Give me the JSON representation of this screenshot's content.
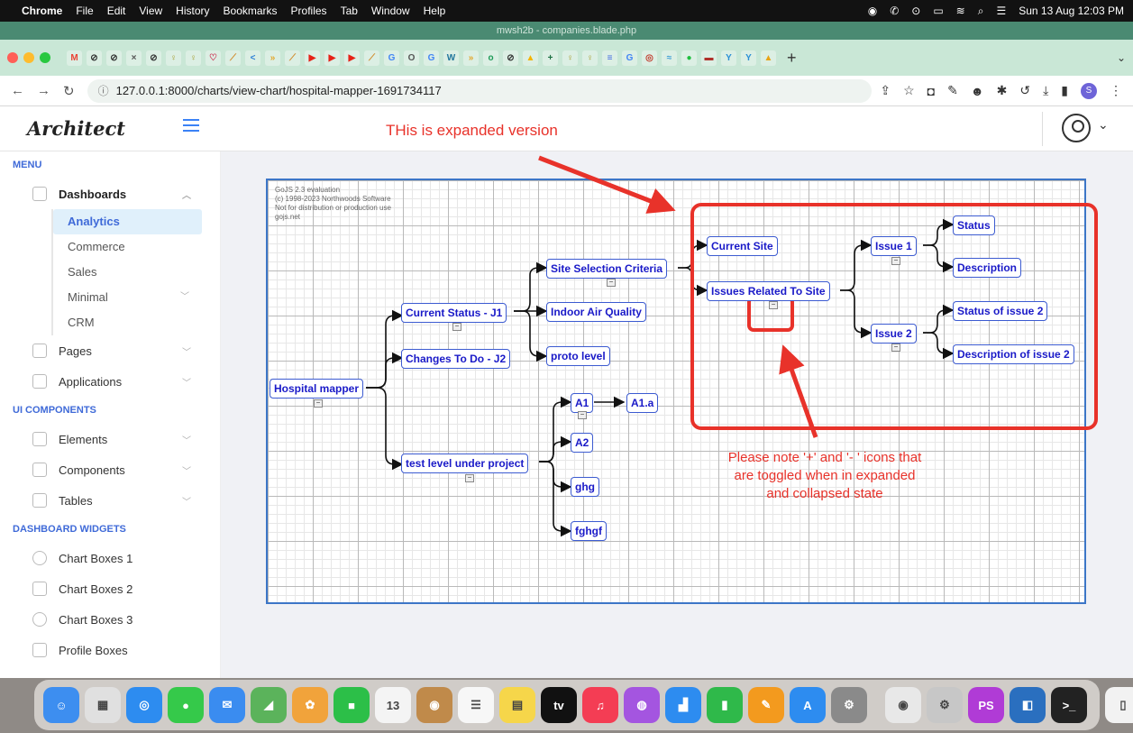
{
  "menubar": {
    "app": "Chrome",
    "items": [
      "File",
      "Edit",
      "View",
      "History",
      "Bookmarks",
      "Profiles",
      "Tab",
      "Window",
      "Help"
    ],
    "clock": "Sun 13 Aug  12:03 PM"
  },
  "window": {
    "title": "mwsh2b - companies.blade.php"
  },
  "browser": {
    "url": "127.0.0.1:8000/charts/view-chart/hospital-mapper-1691734117",
    "favicons": [
      {
        "glyph": "M",
        "color": "#ea4335"
      },
      {
        "glyph": "⊘",
        "color": "#333"
      },
      {
        "glyph": "⊘",
        "color": "#333"
      },
      {
        "glyph": "×",
        "color": "#555"
      },
      {
        "glyph": "⊘",
        "color": "#333"
      },
      {
        "glyph": "♀",
        "color": "#a9a23a"
      },
      {
        "glyph": "♀",
        "color": "#a9a23a"
      },
      {
        "glyph": "♡",
        "color": "#c35"
      },
      {
        "glyph": "⟋",
        "color": "#d08a2a"
      },
      {
        "glyph": "<",
        "color": "#2d7fd6"
      },
      {
        "glyph": "»",
        "color": "#e3a62b"
      },
      {
        "glyph": "⟋",
        "color": "#d08a2a"
      },
      {
        "glyph": "▶",
        "color": "#e62117"
      },
      {
        "glyph": "▶",
        "color": "#e62117"
      },
      {
        "glyph": "▶",
        "color": "#e62117"
      },
      {
        "glyph": "⟋",
        "color": "#d08a2a"
      },
      {
        "glyph": "G",
        "color": "#4285f4"
      },
      {
        "glyph": "O",
        "color": "#555"
      },
      {
        "glyph": "G",
        "color": "#4285f4"
      },
      {
        "glyph": "W",
        "color": "#21759b"
      },
      {
        "glyph": "»",
        "color": "#e3a62b"
      },
      {
        "glyph": "o",
        "color": "#1d9a57"
      },
      {
        "glyph": "⊘",
        "color": "#333"
      },
      {
        "glyph": "▲",
        "color": "#f4b400"
      },
      {
        "glyph": "+",
        "color": "#1d6f42"
      },
      {
        "glyph": "♀",
        "color": "#a9a23a"
      },
      {
        "glyph": "♀",
        "color": "#a9a23a"
      },
      {
        "glyph": "≡",
        "color": "#4169e1"
      },
      {
        "glyph": "G",
        "color": "#4285f4"
      },
      {
        "glyph": "◎",
        "color": "#c0392b"
      },
      {
        "glyph": "≈",
        "color": "#3f9fd6"
      },
      {
        "glyph": "●",
        "color": "#1fbf3f"
      },
      {
        "glyph": "▬",
        "color": "#b0302a"
      },
      {
        "glyph": "Y",
        "color": "#2a8fd6"
      },
      {
        "glyph": "Y",
        "color": "#2a8fd6"
      },
      {
        "glyph": "▲",
        "color": "#e8a317"
      }
    ]
  },
  "header": {
    "brand": "Architect",
    "annotation": "THis is expanded version"
  },
  "sidebar": {
    "menu_title": "MENU",
    "dashboards": "Dashboards",
    "dash_sub": [
      "Analytics",
      "Commerce",
      "Sales",
      "Minimal",
      "CRM"
    ],
    "pages": "Pages",
    "applications": "Applications",
    "ui_title": "UI COMPONENTS",
    "elements": "Elements",
    "components": "Components",
    "tables": "Tables",
    "widgets_title": "DASHBOARD WIDGETS",
    "chart1": "Chart Boxes 1",
    "chart2": "Chart Boxes 2",
    "chart3": "Chart Boxes 3",
    "profile": "Profile Boxes"
  },
  "diagram": {
    "watermark": [
      "GoJS 2.3 evaluation",
      "(c) 1998-2023 Northwoods Software",
      "Not for distribution or production use",
      "gojs.net"
    ],
    "nodes": {
      "root": "Hospital mapper",
      "current_status": "Current Status - J1",
      "changes": "Changes To Do - J2",
      "test_level": "test level under project",
      "site_selection": "Site Selection Criteria",
      "indoor_air": "Indoor Air Quality",
      "proto": "proto level",
      "a1": "A1",
      "a1a": "A1.a",
      "a2": "A2",
      "ghg": "ghg",
      "fghgf": "fghgf",
      "current_site": "Current Site",
      "issues_related": "Issues Related To Site",
      "issue1": "Issue 1",
      "issue2": "Issue 2",
      "status": "Status",
      "description": "Description",
      "status2": "Status of issue 2",
      "description2": "Description of issue 2"
    },
    "toggle_glyph": "−"
  },
  "annotation_note": "Please note '+' and '- ' icons that are toggled when in expanded and collapsed state",
  "dock": {
    "apps": [
      {
        "name": "finder",
        "glyph": "☺",
        "color": "#3d8ef0"
      },
      {
        "name": "launchpad",
        "glyph": "▦",
        "color": "#e0e0e0"
      },
      {
        "name": "safari",
        "glyph": "◎",
        "color": "#2d8cf0"
      },
      {
        "name": "messages",
        "glyph": "●",
        "color": "#35c94a"
      },
      {
        "name": "mail",
        "glyph": "✉",
        "color": "#3a8cf0"
      },
      {
        "name": "maps",
        "glyph": "◢",
        "color": "#5bb35b"
      },
      {
        "name": "photos",
        "glyph": "✿",
        "color": "#f1a33b"
      },
      {
        "name": "facetime",
        "glyph": "■",
        "color": "#2cbf48"
      },
      {
        "name": "calendar",
        "glyph": "13",
        "color": "#f4f4f4"
      },
      {
        "name": "contacts",
        "glyph": "◉",
        "color": "#c08a4a"
      },
      {
        "name": "reminders",
        "glyph": "☰",
        "color": "#f7f7f7"
      },
      {
        "name": "notes",
        "glyph": "▤",
        "color": "#f6d64a"
      },
      {
        "name": "apple-tv",
        "glyph": "tv",
        "color": "#111"
      },
      {
        "name": "music",
        "glyph": "♫",
        "color": "#f43d54"
      },
      {
        "name": "podcasts",
        "glyph": "◍",
        "color": "#a455e0"
      },
      {
        "name": "keynote",
        "glyph": "▟",
        "color": "#2d8cf0"
      },
      {
        "name": "numbers",
        "glyph": "▮",
        "color": "#2fb94a"
      },
      {
        "name": "pages",
        "glyph": "✎",
        "color": "#f39a1e"
      },
      {
        "name": "app-store",
        "glyph": "A",
        "color": "#2d8cf0"
      },
      {
        "name": "system-settings",
        "glyph": "⚙",
        "color": "#8a8a8a"
      },
      {
        "name": "chrome",
        "glyph": "◉",
        "color": "#e8e8e8"
      },
      {
        "name": "disk-utility",
        "glyph": "⚙",
        "color": "#c7c7c7"
      },
      {
        "name": "phpstorm",
        "glyph": "PS",
        "color": "#b03bd6"
      },
      {
        "name": "sourcetree",
        "glyph": "◧",
        "color": "#2a6fbf"
      },
      {
        "name": "terminal",
        "glyph": ">_",
        "color": "#222"
      },
      {
        "name": "archive",
        "glyph": "▯",
        "color": "#f2f2f2"
      },
      {
        "name": "trash",
        "glyph": "♲",
        "color": "#d6d6d6"
      }
    ]
  }
}
